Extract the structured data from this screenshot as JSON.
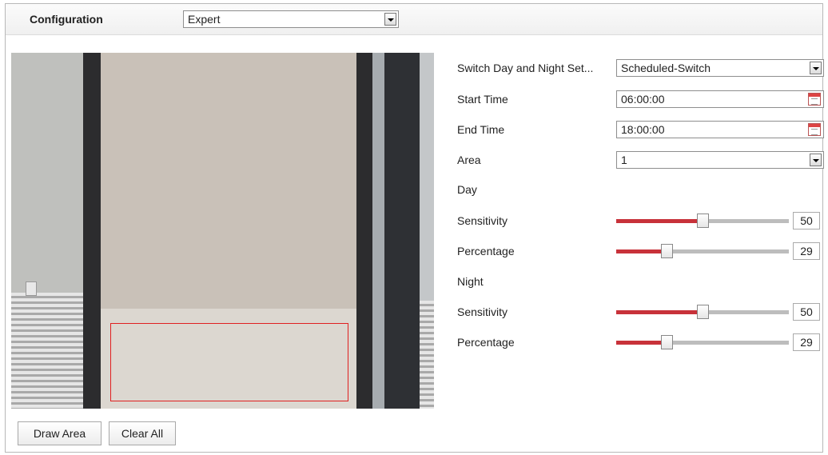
{
  "header": {
    "configuration_label": "Configuration",
    "mode_value": "Expert"
  },
  "video": {
    "draw_area_label": "Draw Area",
    "clear_all_label": "Clear All"
  },
  "settings": {
    "switch_label": "Switch Day and Night Set...",
    "switch_value": "Scheduled-Switch",
    "start_time_label": "Start Time",
    "start_time_value": "06:00:00",
    "end_time_label": "End Time",
    "end_time_value": "18:00:00",
    "area_label": "Area",
    "area_value": "1",
    "day": {
      "label": "Day",
      "sensitivity_label": "Sensitivity",
      "sensitivity_value": "50",
      "sensitivity_fraction": 0.5,
      "percentage_label": "Percentage",
      "percentage_value": "29",
      "percentage_fraction": 0.29
    },
    "night": {
      "label": "Night",
      "sensitivity_label": "Sensitivity",
      "sensitivity_value": "50",
      "sensitivity_fraction": 0.5,
      "percentage_label": "Percentage",
      "percentage_value": "29",
      "percentage_fraction": 0.29
    }
  },
  "icons": {
    "dropdown": "chevron-down-icon",
    "calendar": "calendar-icon"
  },
  "colors": {
    "slider_fill": "#c8323a",
    "area_rect": "#e02020"
  }
}
